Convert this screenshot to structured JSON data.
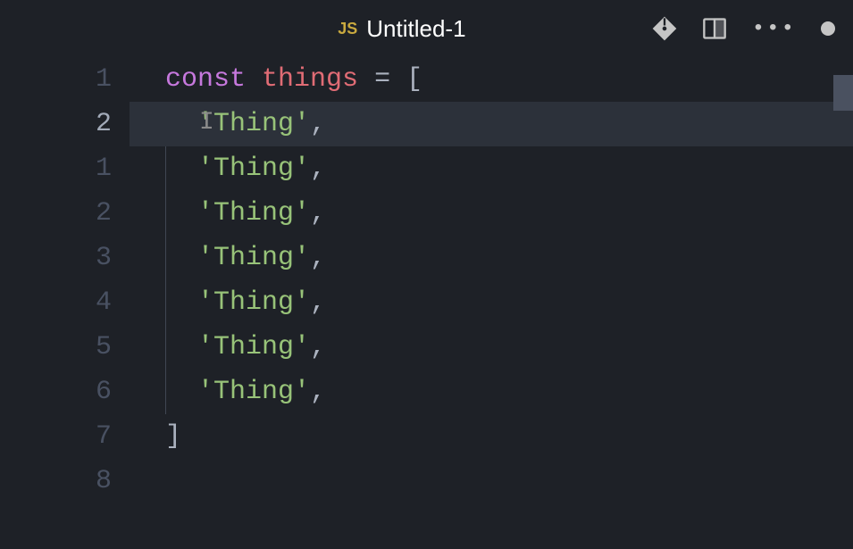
{
  "tab": {
    "icon_label": "JS",
    "filename": "Untitled-1"
  },
  "gutter": {
    "numbers": [
      "1",
      "2",
      "1",
      "2",
      "3",
      "4",
      "5",
      "6",
      "7",
      "8"
    ],
    "active_index": 1
  },
  "code": {
    "declaration": {
      "keyword": "const",
      "variable": "things",
      "operator": "=",
      "open_bracket": "["
    },
    "items": [
      "'Thing'",
      "'Thing'",
      "'Thing'",
      "'Thing'",
      "'Thing'",
      "'Thing'",
      "'Thing'"
    ],
    "close_bracket": "]",
    "highlighted_item_index": 0
  }
}
